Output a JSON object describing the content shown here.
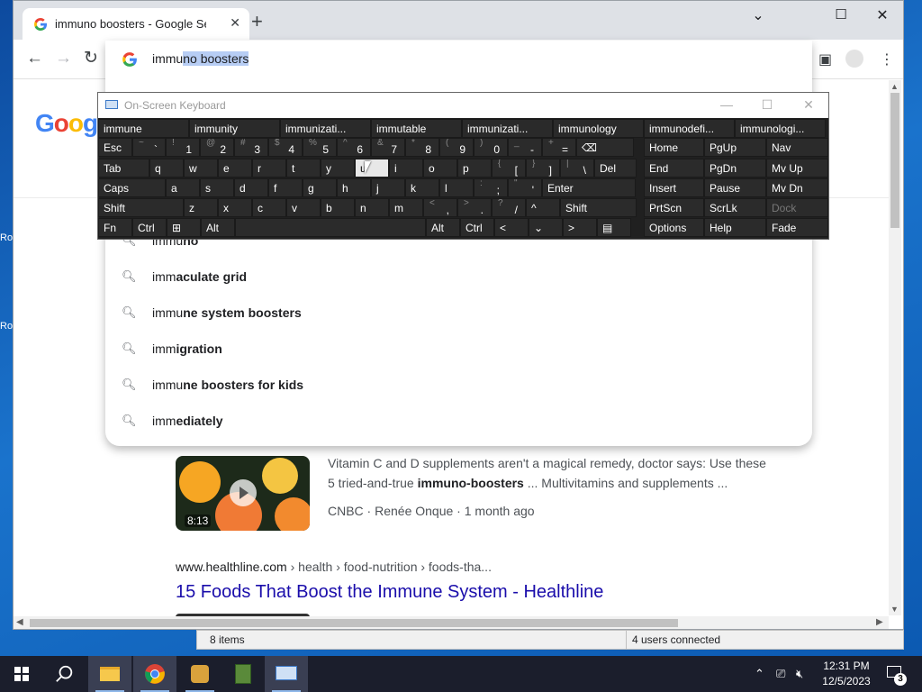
{
  "desktop": {
    "labels": [
      "Ro",
      "Ro"
    ]
  },
  "browser": {
    "tab_title": "immuno boosters - Google Sear",
    "window_controls": {
      "minimize": "⌄",
      "maximize": "☐",
      "close": "✕"
    },
    "omnibox": {
      "typed": "immu",
      "selected": "no boosters"
    },
    "suggestions": [
      {
        "plain": "immu",
        "bold": "no"
      },
      {
        "plain": "imm",
        "bold": "aculate grid"
      },
      {
        "plain": "immu",
        "bold": "ne system boosters"
      },
      {
        "plain": "imm",
        "bold": "igration"
      },
      {
        "plain": "immu",
        "bold": "ne boosters for kids"
      },
      {
        "plain": "imm",
        "bold": "ediately"
      }
    ],
    "google_logo": "Goog",
    "video_result": {
      "line1": "Vitamin C and D supplements aren't a magical remedy, doctor says: Use these",
      "line2_pre": "5 tried-and-true ",
      "line2_bold": "immuno-boosters",
      "line2_post": " ... Multivitamins and supplements ...",
      "meta": "CNBC · Renée Onque · 1 month ago",
      "duration": "8:13"
    },
    "result2": {
      "host": "www.healthline.com",
      "path": " › health › food-nutrition › foods-tha...",
      "title": "15 Foods That Boost the Immune System - Healthline"
    }
  },
  "statusbar": {
    "items": "8 items",
    "users": "4 users connected"
  },
  "osk": {
    "title": "On-Screen Keyboard",
    "predictions": [
      "immune",
      "immunity",
      "immunizati...",
      "immutable",
      "immunizati...",
      "immunology",
      "immunodefi...",
      "immunologi..."
    ],
    "row1": [
      {
        "l": "Esc"
      },
      {
        "s": "~",
        "m": "`"
      },
      {
        "s": "!",
        "m": "1"
      },
      {
        "s": "@",
        "m": "2"
      },
      {
        "s": "#",
        "m": "3"
      },
      {
        "s": "$",
        "m": "4"
      },
      {
        "s": "%",
        "m": "5"
      },
      {
        "s": "^",
        "m": "6"
      },
      {
        "s": "&",
        "m": "7"
      },
      {
        "s": "*",
        "m": "8"
      },
      {
        "s": "(",
        "m": "9"
      },
      {
        "s": ")",
        "m": "0"
      },
      {
        "s": "_",
        "m": "-"
      },
      {
        "s": "+",
        "m": "="
      },
      {
        "l": "⌫"
      }
    ],
    "row2": [
      {
        "l": "Tab"
      },
      {
        "l": "q"
      },
      {
        "l": "w"
      },
      {
        "l": "e"
      },
      {
        "l": "r"
      },
      {
        "l": "t"
      },
      {
        "l": "y"
      },
      {
        "l": "u"
      },
      {
        "l": "i"
      },
      {
        "l": "o"
      },
      {
        "l": "p"
      },
      {
        "s": "{",
        "m": "["
      },
      {
        "s": "}",
        "m": "]"
      },
      {
        "s": "|",
        "m": "\\"
      },
      {
        "l": "Del"
      }
    ],
    "row3": [
      {
        "l": "Caps"
      },
      {
        "l": "a"
      },
      {
        "l": "s"
      },
      {
        "l": "d"
      },
      {
        "l": "f"
      },
      {
        "l": "g"
      },
      {
        "l": "h"
      },
      {
        "l": "j"
      },
      {
        "l": "k"
      },
      {
        "l": "l"
      },
      {
        "s": ":",
        "m": ";"
      },
      {
        "s": "\"",
        "m": "'"
      },
      {
        "l": "Enter"
      }
    ],
    "row4": [
      {
        "l": "Shift"
      },
      {
        "l": "z"
      },
      {
        "l": "x"
      },
      {
        "l": "c"
      },
      {
        "l": "v"
      },
      {
        "l": "b"
      },
      {
        "l": "n"
      },
      {
        "l": "m"
      },
      {
        "s": "<",
        "m": ","
      },
      {
        "s": ">",
        "m": "."
      },
      {
        "s": "?",
        "m": "/"
      },
      {
        "l": "^"
      },
      {
        "l": "Shift"
      }
    ],
    "row5": [
      {
        "l": "Fn"
      },
      {
        "l": "Ctrl"
      },
      {
        "l": "⊞"
      },
      {
        "l": "Alt"
      },
      {
        "l": ""
      },
      {
        "l": "Alt"
      },
      {
        "l": "Ctrl"
      },
      {
        "l": "<"
      },
      {
        "l": "⌄"
      },
      {
        "l": ">"
      },
      {
        "l": "▤"
      }
    ],
    "side": [
      [
        "Home",
        "PgUp",
        "Nav"
      ],
      [
        "End",
        "PgDn",
        "Mv Up"
      ],
      [
        "Insert",
        "Pause",
        "Mv Dn"
      ],
      [
        "PrtScn",
        "ScrLk",
        "Dock"
      ],
      [
        "Options",
        "Help",
        "Fade"
      ]
    ],
    "pressed_key": "u"
  },
  "taskbar": {
    "clock_time": "12:31 PM",
    "clock_date": "12/5/2023",
    "notification_count": "3"
  }
}
